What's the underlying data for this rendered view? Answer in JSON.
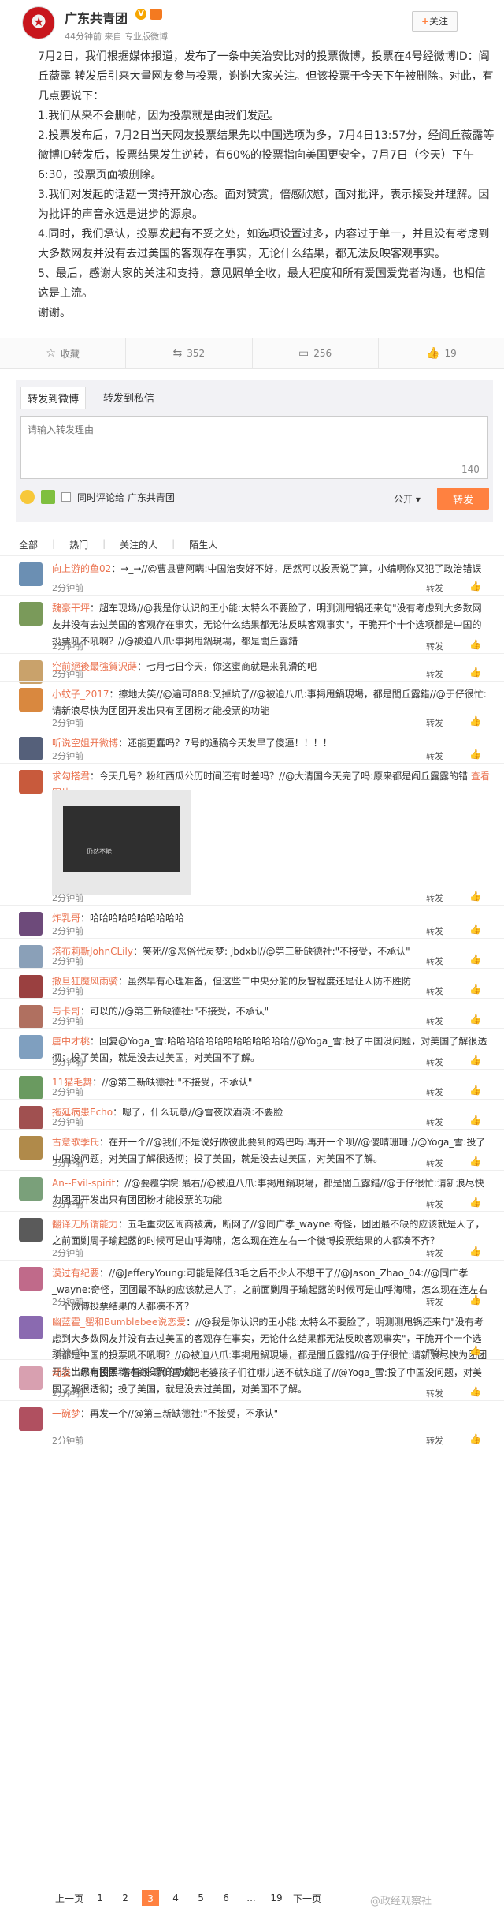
{
  "post": {
    "author": "广东共青团",
    "verified_badge": "V",
    "meta": "44分钟前 来自 专业版微博",
    "follow_label": "关注",
    "paragraphs": [
      "7月2日，我们根据媒体报道，发布了一条中美治安比对的投票微博，投票在4号经微博ID：阎丘薇露 转发后引来大量网友参与投票，谢谢大家关注。但该投票于今天下午被删除。对此，有几点要说下：",
      "1.我们从来不会删帖，因为投票就是由我们发起。",
      "2.投票发布后，7月2日当天网友投票结果先以中国选项为多，7月4日13:57分，经阎丘薇露等微博ID转发后，投票结果发生逆转，有60%的投票指向美国更安全，7月7日（今天）下午6:30，投票页面被删除。",
      "3.我们对发起的话题一贯持开放心态。面对赞赏，倍感欣慰，面对批评，表示接受并理解。因为批评的声音永远是进步的源泉。",
      "4.同时，我们承认，投票发起有不妥之处，如选项设置过多，内容过于单一，并且没有考虑到大多数网友并没有去过美国的客观存在事实，无论什么结果，都无法反映客观事实。",
      "5、最后，感谢大家的关注和支持，意见照单全收，最大程度和所有爱国爱党者沟通，也相信这是主流。",
      "谢谢。"
    ]
  },
  "actions": {
    "collect": "收藏",
    "repost_count": "352",
    "comment_count": "256",
    "like_count": "19"
  },
  "repost": {
    "tab_weibo": "转发到微博",
    "tab_private": "转发到私信",
    "placeholder": "请输入转发理由",
    "counter": "140",
    "also_comment": "同时评论给 广东共青团",
    "visibility": "公开",
    "send_label": "转发"
  },
  "filters": [
    "全部",
    "热门",
    "关注的人",
    "陌生人"
  ],
  "comments": [
    {
      "user": "向上游的鱼02",
      "text": "：→_→//@曹县曹阿瞒:中国治安好不好，居然可以投票说了算，小编啊你又犯了政治错误",
      "time": "2分钟前",
      "reply": "转发",
      "color": "#6b8fb3"
    },
    {
      "user": "魏豪干坪",
      "text": "：超车现场//@我是你认识的王小能:太特么不要脸了，明测测甩锅还来句\"没有考虑到大多数网友并没有去过美国的客观存在事实，无论什么结果都无法反映客观事实\"，干脆开个十个选项都是中国的投票吼不吼啊？//@被迫八爪:事掲甩鍋現場，都是閭丘露錯",
      "time": "2分钟前",
      "reply": "转发",
      "color": "#7a9a5a"
    },
    {
      "user": "空前絕後最強賀沢蒔",
      "text": "：七月七日今天，你这蜜商就是来乳滑的吧",
      "time": "2分钟前",
      "reply": "转发",
      "color": "#c9a26b"
    },
    {
      "user": "小蚊子_2017",
      "text": "：擦地大笑//@遍可888:又掉坑了//@被迫八爪:事掲甩鍋現場，都是閭丘露錯//@于仔很忙:请新浪尽快为团团开发出只有团团粉才能投票的功能",
      "time": "2分钟前",
      "reply": "转发",
      "color": "#d9883f"
    },
    {
      "user": "听说空姐开微博",
      "text": "：还能更蠢吗？7号的通稿今天发早了傻逼！！！！",
      "time": "2分钟前",
      "reply": "转发",
      "color": "#55607a"
    },
    {
      "user": "求勾搭君",
      "text": "：今天几号？粉红西瓜公历时间还有时差吗？//@大清国今天完了吗:原来都是阎丘露露的错",
      "view_big": "查看图片",
      "image_caption": "仍然不能",
      "time": "2分钟前",
      "reply": "转发",
      "color": "#c85a3c",
      "has_image": true
    },
    {
      "user": "炸乳哥",
      "text": "：哈哈哈哈哈哈哈哈哈哈",
      "time": "2分钟前",
      "reply": "转发",
      "color": "#6d4a7a"
    },
    {
      "user": "塔布莉斯JohnCLily",
      "text": "：笑死//@恶俗代灵梦: jbdxbl//@第三新缺德社:\"不接受，不承认\"",
      "time": "2分钟前",
      "reply": "转发",
      "color": "#8aa0b8"
    },
    {
      "user": "撒旦狂魔风雨骑",
      "text": "：虽然早有心理准备，但这些二中央分舵的反智程度还是让人防不胜防",
      "time": "2分钟前",
      "reply": "转发",
      "color": "#9a4040"
    },
    {
      "user": "与卡哥",
      "text": "：可以的//@第三新缺德社:\"不接受，不承认\"",
      "time": "2分钟前",
      "reply": "转发",
      "color": "#b07060"
    },
    {
      "user": "唐中才桃",
      "text": "：回复@Yoga_雪:哈哈哈哈哈哈哈哈哈哈哈哈哈//@Yoga_雪:投了中国没问题，对美国了解很透彻：投了美国，就是没去过美国，对美国不了解。",
      "time": "2分钟前",
      "reply": "转发",
      "color": "#7f9fbf"
    },
    {
      "user": "11猫毛舞",
      "text": "：//@第三新缺德社:\"不接受，不承认\"",
      "time": "2分钟前",
      "reply": "转发",
      "color": "#6a9a60"
    },
    {
      "user": "拖延病患Echo",
      "text": "：嗯了，什么玩意//@雪夜饮酒浇:不要脸",
      "time": "2分钟前",
      "reply": "转发",
      "color": "#a05050"
    },
    {
      "user": "古意歌季氏",
      "text": "：在开一个//@我们不是说好做彼此要到的鸡巴吗:再开一个呗//@傻晴珊珊://@Yoga_雪:投了中国没问题，对美国了解很透彻；投了美国，就是没去过美国，对美国不了解。",
      "time": "2分钟前",
      "reply": "转发",
      "color": "#b08a4a"
    },
    {
      "user": "An--Evil-spirit",
      "text": "：//@要覆学院:最右//@被迫八爪:事掲甩鍋現場，都是閭丘露錯//@于仔很忙:请新浪尽快为团团开发出只有团团粉才能投票的功能",
      "time": "2分钟前",
      "reply": "转发",
      "color": "#7aa07a"
    },
    {
      "user": "翻译无所谓能力",
      "text": "：五毛重灾区闹商被满，断网了//@同广孝_wayne:奇怪，团团最不缺的应该就是人了，之前面剿周子瑜起蕗的时候可是山呼海啸，怎么现在连左右一个微博投票结果的人都凑不齐？",
      "time": "2分钟前",
      "reply": "转发",
      "color": "#5a5a5a"
    },
    {
      "user": "漠过有纪要",
      "text": "：//@JefferyYoung:可能是降低3毛之后不少人不想干了//@Jason_Zhao_04://@同广孝_wayne:奇怪，团团最不缺的应该就是人了，之前面剿周子瑜起蕗的时候可是山呼海啸，怎么现在连左右一个微博投票结果的人都凑不齐？",
      "time": "2分钟前",
      "reply": "转发",
      "color": "#c06a8a"
    },
    {
      "user": "幽蓝霍_罂和Bumblebee说恋爱",
      "text": "：//@我是你认识的王小能:太特么不要脸了，明测测甩锅还来句\"没有考虑到大多数网友并没有去过美国的客观存在事实，无论什么结果都无法反映客观事实\"，干脆开个十个选项都是中国的投票吼不吼啊？//@被迫八爪:事掲甩鍋現場，都是閭丘露錯//@于仔很忙:请新浪尽快为团团开发出只有团团粉才能投票的功能",
      "time": "2分钟前",
      "reply": "转发",
      "color": "#8a6ab0"
    },
    {
      "user": "动姿",
      "text": "：哪用投票 看看领 导们喜欢把老婆孩子们往哪儿送不就知道了//@Yoga_雪:投了中国没问题，对美国了解很透彻；投了美国，就是没去过美国，对美国不了解。",
      "time": "2分钟前",
      "reply": "转发",
      "color": "#d8a0b0"
    },
    {
      "user": "一碗梦",
      "text": "：再发一个//@第三新缺德社:\"不接受，不承认\"",
      "time": "2分钟前",
      "reply": "转发",
      "color": "#b05060"
    }
  ],
  "pager": {
    "prev": "上一页",
    "pages": [
      "1",
      "2",
      "3",
      "4",
      "5",
      "6",
      "...",
      "19"
    ],
    "current": "3",
    "next": "下一页"
  },
  "watermark": "@政经观察社"
}
